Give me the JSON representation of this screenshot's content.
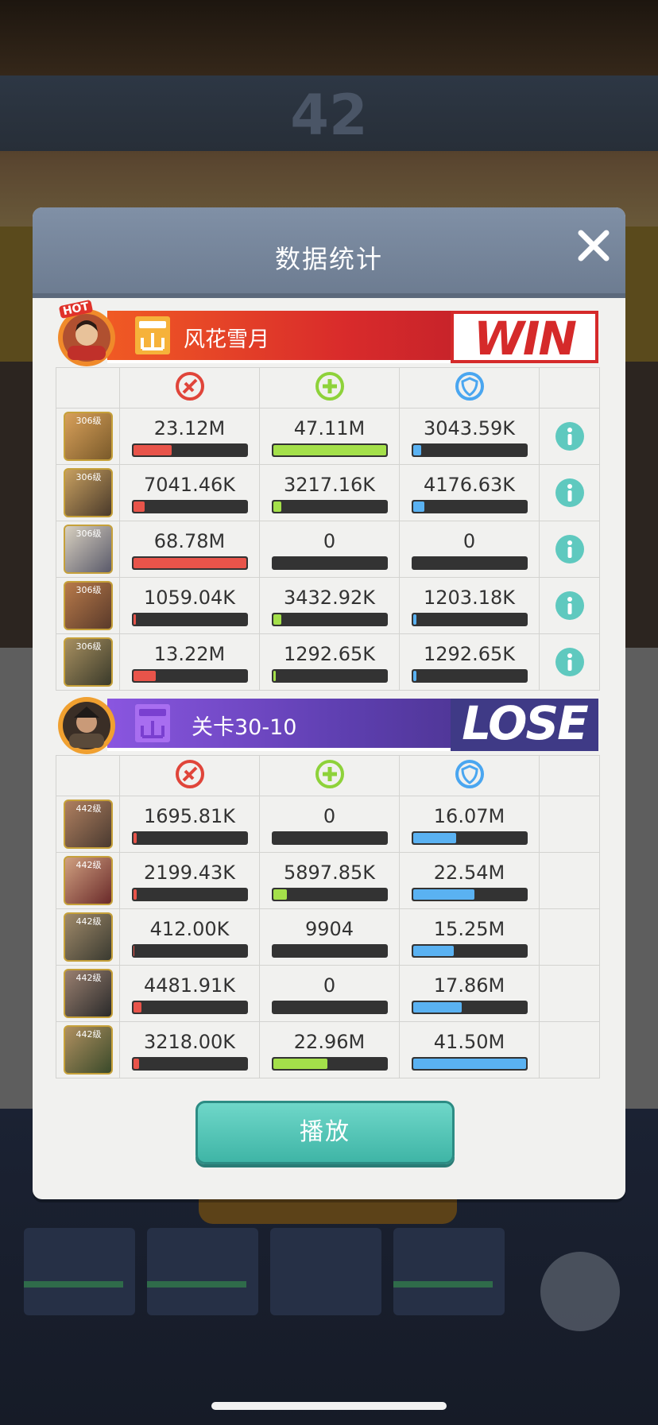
{
  "background": {
    "score_text": "42"
  },
  "dialog": {
    "title": "数据统计"
  },
  "stat_icons": [
    "damage-icon",
    "heal-icon",
    "shield-icon"
  ],
  "teams": [
    {
      "name": "风花雪月",
      "result": "WIN",
      "avatar_badge": "HOT",
      "rows": [
        {
          "level": "306级",
          "damage": "23.12M",
          "damage_fill": 0.34,
          "heal": "47.11M",
          "heal_fill": 1.0,
          "shield": "3043.59K",
          "shield_fill": 0.07
        },
        {
          "level": "306级",
          "damage": "7041.46K",
          "damage_fill": 0.1,
          "heal": "3217.16K",
          "heal_fill": 0.07,
          "shield": "4176.63K",
          "shield_fill": 0.1
        },
        {
          "level": "306级",
          "damage": "68.78M",
          "damage_fill": 1.0,
          "heal": "0",
          "heal_fill": 0,
          "shield": "0",
          "shield_fill": 0
        },
        {
          "level": "306级",
          "damage": "1059.04K",
          "damage_fill": 0.02,
          "heal": "3432.92K",
          "heal_fill": 0.07,
          "shield": "1203.18K",
          "shield_fill": 0.03
        },
        {
          "level": "306级",
          "damage": "13.22M",
          "damage_fill": 0.2,
          "heal": "1292.65K",
          "heal_fill": 0.02,
          "shield": "1292.65K",
          "shield_fill": 0.03
        }
      ]
    },
    {
      "name": "关卡30-10",
      "result": "LOSE",
      "rows": [
        {
          "level": "442级",
          "damage": "1695.81K",
          "damage_fill": 0.03,
          "heal": "0",
          "heal_fill": 0,
          "shield": "16.07M",
          "shield_fill": 0.38
        },
        {
          "level": "442级",
          "damage": "2199.43K",
          "damage_fill": 0.03,
          "heal": "5897.85K",
          "heal_fill": 0.12,
          "shield": "22.54M",
          "shield_fill": 0.54
        },
        {
          "level": "442级",
          "damage": "412.00K",
          "damage_fill": 0.01,
          "heal": "9904",
          "heal_fill": 0,
          "shield": "15.25M",
          "shield_fill": 0.36
        },
        {
          "level": "442级",
          "damage": "4481.91K",
          "damage_fill": 0.07,
          "heal": "0",
          "heal_fill": 0,
          "shield": "17.86M",
          "shield_fill": 0.43
        },
        {
          "level": "442级",
          "damage": "3218.00K",
          "damage_fill": 0.05,
          "heal": "22.96M",
          "heal_fill": 0.48,
          "shield": "41.50M",
          "shield_fill": 1.0
        }
      ]
    }
  ],
  "play_button": {
    "label": "播放"
  },
  "colors": {
    "damage": "#e8544a",
    "heal": "#a4e04a",
    "shield": "#5ab2f2",
    "info": "#5fc9bf",
    "win": "#d52a2a",
    "lose": "#3f3a86"
  }
}
